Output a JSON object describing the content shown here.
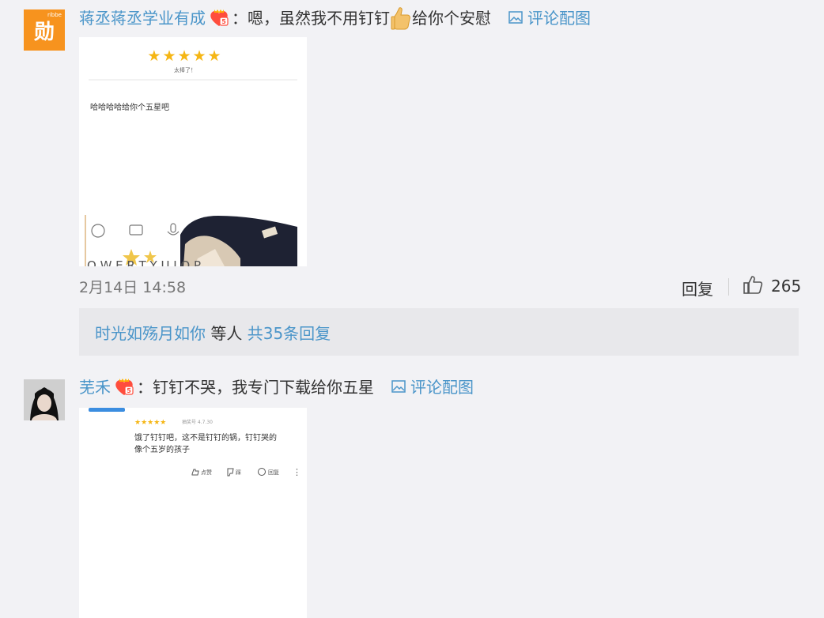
{
  "comments": [
    {
      "username": "蒋丞蒋丞学业有成",
      "avatar_text": "勋",
      "avatar_tiny": "ribbe",
      "badge": "vip-heart-badge",
      "text_before_emoji": "：嗯，虽然我不用钉钉",
      "emoji": "thumbs-up-emoji",
      "text_after_emoji": "给你个安慰",
      "image_link_label": "评论配图",
      "image": {
        "stars": "★★★★★",
        "rating_caption": "太棒了！",
        "review_text": "哈哈哈哈给你个五星吧",
        "keyboard_row": "Q W E R T Y U I O P"
      },
      "time": "2月14日 14:58",
      "reply_label": "回复",
      "like_count": "265",
      "replies": {
        "user": "时光如殇月如你",
        "middle": " 等人 ",
        "total": "共35条回复"
      }
    },
    {
      "username": "芜禾",
      "badge": "vip-heart-badge",
      "text": "：钉钉不哭，我专门下载给你五星",
      "image_link_label": "评论配图",
      "image": {
        "stars": "★★★★★",
        "review_meta": "抽奖号 4.7.30",
        "review_line1": "饿了钉钉吧，这不是钉钉的锅，钉钉哭的",
        "review_line2": "像个五岁的孩子",
        "actions": [
          "点赞",
          "踩",
          "回复"
        ],
        "more": "⋮"
      }
    }
  ],
  "colors": {
    "link_blue": "#4a95c9",
    "background": "#f2f2f5",
    "reply_box": "#e8e8eb",
    "avatar_orange": "#f7931e",
    "star_gold": "#f5b614"
  }
}
